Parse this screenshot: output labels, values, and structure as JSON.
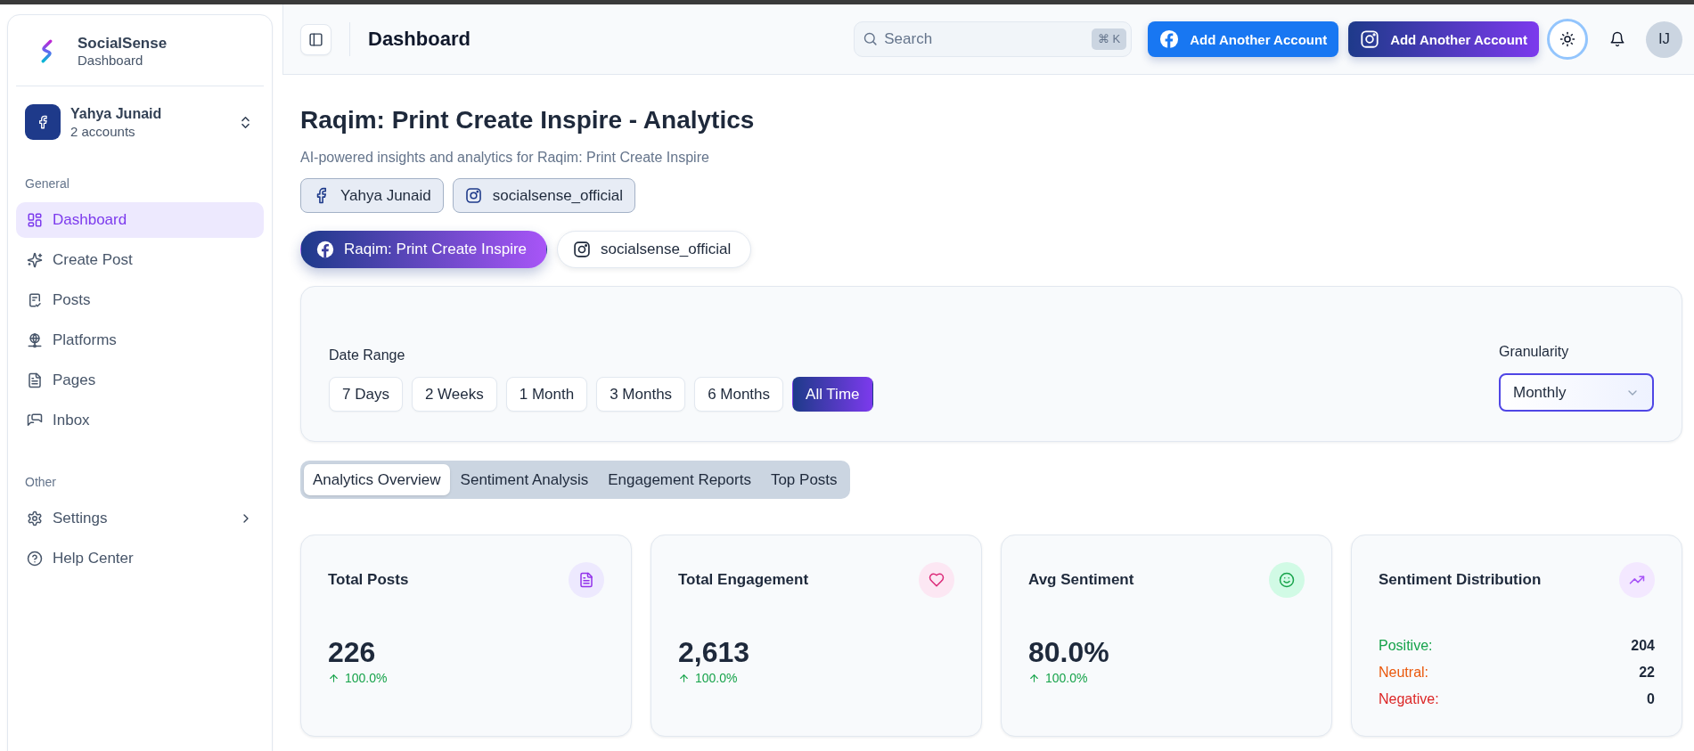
{
  "sidebar": {
    "brand": {
      "name": "SocialSense",
      "subtitle": "Dashboard"
    },
    "account": {
      "name": "Yahya Junaid",
      "detail": "2 accounts"
    },
    "sections": [
      {
        "heading": "General",
        "items": [
          {
            "label": "Dashboard",
            "selected": true,
            "has_submenu": false
          },
          {
            "label": "Create Post",
            "selected": false,
            "has_submenu": false
          },
          {
            "label": "Posts",
            "selected": false,
            "has_submenu": false
          },
          {
            "label": "Platforms",
            "selected": false,
            "has_submenu": false
          },
          {
            "label": "Pages",
            "selected": false,
            "has_submenu": false
          },
          {
            "label": "Inbox",
            "selected": false,
            "has_submenu": false
          }
        ]
      },
      {
        "heading": "Other",
        "items": [
          {
            "label": "Settings",
            "selected": false,
            "has_submenu": true
          },
          {
            "label": "Help Center",
            "selected": false,
            "has_submenu": false
          }
        ]
      }
    ]
  },
  "header": {
    "title": "Dashboard",
    "search": {
      "placeholder": "Search",
      "shortcut": "⌘ K"
    },
    "actions": [
      {
        "kind": "facebook",
        "label": "Add Another Account"
      },
      {
        "kind": "instagram",
        "label": "Add Another Account"
      }
    ],
    "user": {
      "initials": "IJ"
    }
  },
  "page": {
    "title": "Raqim: Print Create Inspire - Analytics",
    "subtitle": "AI-powered insights and analytics for Raqim: Print Create Inspire",
    "accounts": [
      {
        "kind": "facebook",
        "label": "Yahya Junaid"
      },
      {
        "kind": "instagram",
        "label": "socialsense_official"
      }
    ],
    "page_switcher": [
      {
        "kind": "facebook",
        "label": "Raqim: Print Create Inspire",
        "selected": true
      },
      {
        "kind": "instagram",
        "label": "socialsense_official",
        "selected": false
      }
    ]
  },
  "filters": {
    "date_range": {
      "label": "Date Range",
      "options": [
        {
          "label": "7 Days",
          "selected": false
        },
        {
          "label": "2 Weeks",
          "selected": false
        },
        {
          "label": "1 Month",
          "selected": false
        },
        {
          "label": "3 Months",
          "selected": false
        },
        {
          "label": "6 Months",
          "selected": false
        },
        {
          "label": "All Time",
          "selected": true
        }
      ]
    },
    "granularity": {
      "label": "Granularity",
      "value": "Monthly"
    }
  },
  "tabs": [
    {
      "label": "Analytics Overview",
      "selected": true
    },
    {
      "label": "Sentiment Analysis",
      "selected": false
    },
    {
      "label": "Engagement Reports",
      "selected": false
    },
    {
      "label": "Top Posts",
      "selected": false
    }
  ],
  "stats": [
    {
      "kind": "metric",
      "title": "Total Posts",
      "value": "226",
      "change": "100.0%"
    },
    {
      "kind": "metric",
      "title": "Total Engagement",
      "value": "2,613",
      "change": "100.0%"
    },
    {
      "kind": "metric",
      "title": "Avg Sentiment",
      "value": "80.0%",
      "change": "100.0%"
    },
    {
      "kind": "distribution",
      "title": "Sentiment Distribution",
      "rows": [
        {
          "label": "Positive:",
          "value": "204",
          "color": "#16a34a"
        },
        {
          "label": "Neutral:",
          "value": "22",
          "color": "#ea580c"
        },
        {
          "label": "Negative:",
          "value": "0",
          "color": "#dc2626"
        }
      ]
    }
  ]
}
